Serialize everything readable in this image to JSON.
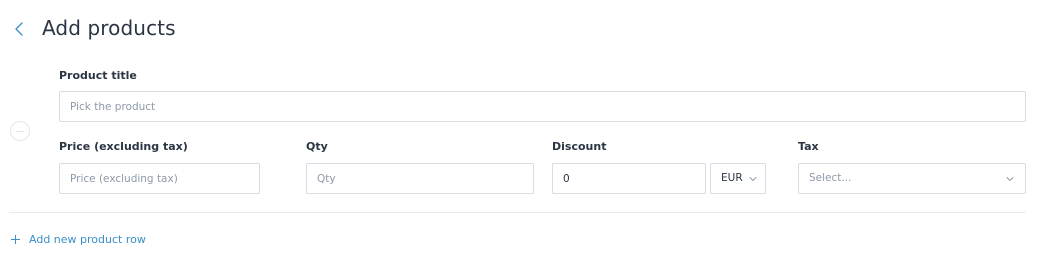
{
  "header": {
    "back_icon": "chevron-left-icon",
    "title": "Add products"
  },
  "product_row": {
    "remove_icon": "minus-circle-icon",
    "product_title": {
      "label": "Product title",
      "placeholder": "Pick the product",
      "value": ""
    },
    "price": {
      "label": "Price (excluding tax)",
      "placeholder": "Price (excluding tax)",
      "value": ""
    },
    "qty": {
      "label": "Qty",
      "placeholder": "Qty",
      "value": ""
    },
    "discount": {
      "label": "Discount",
      "value": "0",
      "currency": "EUR",
      "currency_icon": "chevron-down-icon"
    },
    "tax": {
      "label": "Tax",
      "placeholder": "Select...",
      "icon": "chevron-down-icon"
    }
  },
  "footer": {
    "add_icon": "plus-icon",
    "add_label": "Add new product row"
  },
  "colors": {
    "text": "#2b3543",
    "placeholder": "#8d9aa8",
    "border": "#d6dde4",
    "accent": "#3a8fc9",
    "divider": "#e8ecf0"
  }
}
